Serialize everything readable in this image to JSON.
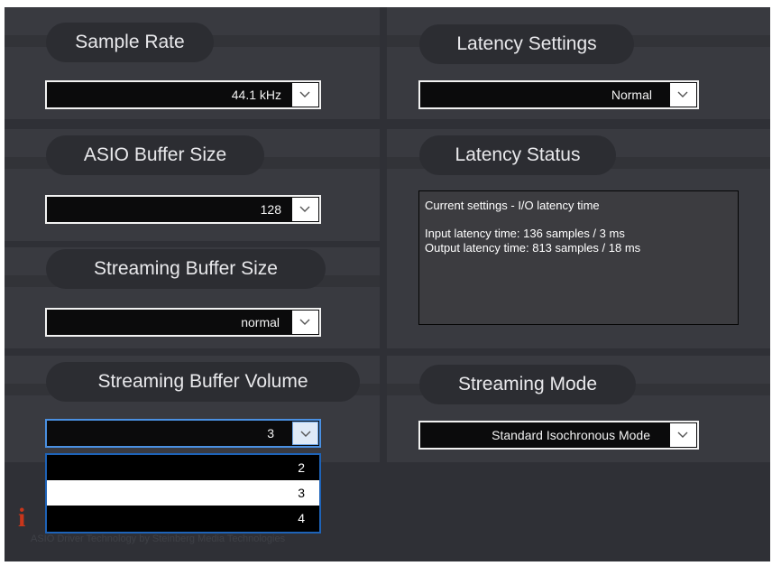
{
  "sample_rate": {
    "title": "Sample Rate",
    "value": "44.1 kHz"
  },
  "latency_settings": {
    "title": "Latency Settings",
    "value": "Normal"
  },
  "asio_buffer": {
    "title": "ASIO Buffer Size",
    "value": "128"
  },
  "latency_status": {
    "title": "Latency Status",
    "line1": "Current settings - I/O latency time",
    "line2": "Input latency time: 136 samples / 3 ms",
    "line3": "Output latency time: 813 samples / 18 ms"
  },
  "streaming_buffer_size": {
    "title": "Streaming Buffer Size",
    "value": "normal"
  },
  "streaming_buffer_volume": {
    "title": "Streaming Buffer Volume",
    "value": "3",
    "options": [
      "2",
      "3",
      "4"
    ]
  },
  "streaming_mode": {
    "title": "Streaming Mode",
    "value": "Standard Isochronous Mode"
  },
  "footer": {
    "logo_text": "i",
    "text": "ASIO Driver Technology by Steinberg Media Technologies"
  },
  "icons": {
    "dropdown_arrow": "chevron-down-icon"
  }
}
